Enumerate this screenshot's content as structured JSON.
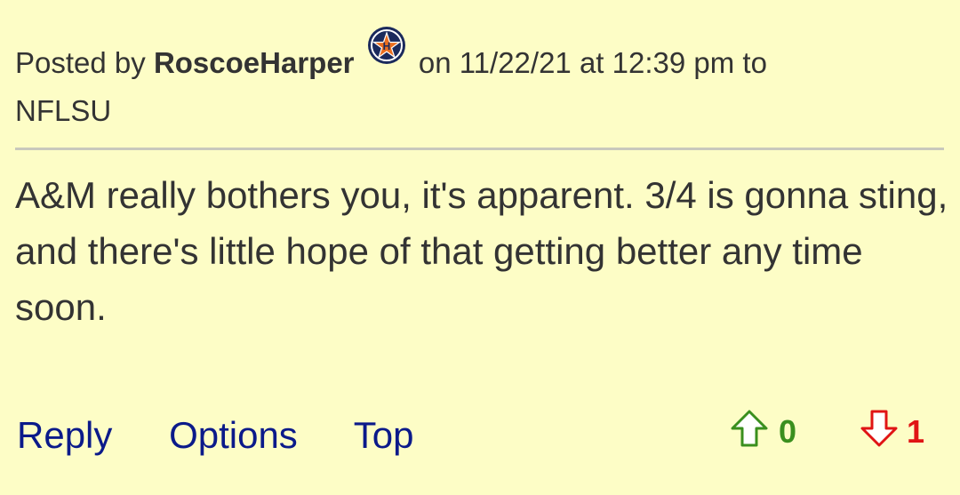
{
  "post": {
    "posted_by_prefix": "Posted by",
    "author": "RoscoeHarper",
    "team_icon": "houston-astros-logo-icon",
    "date_prefix": "on",
    "date": "11/22/21",
    "time_prefix": "at",
    "time": "12:39 pm",
    "to_prefix": "to",
    "to_user": "NFLSU",
    "body": "A&M really bothers you, it's apparent. 3/4 is gonna sting, and there's little hope of that getting better any time soon."
  },
  "actions": {
    "reply": "Reply",
    "options": "Options",
    "top": "Top"
  },
  "votes": {
    "up_icon": "thumbs-up-arrow-icon",
    "up_count": "0",
    "down_icon": "thumbs-down-arrow-icon",
    "down_count": "1"
  },
  "colors": {
    "background": "#fdfdc6",
    "text": "#333333",
    "link": "#0b1a8a",
    "upvote": "#3a8f1e",
    "downvote": "#e01414"
  }
}
